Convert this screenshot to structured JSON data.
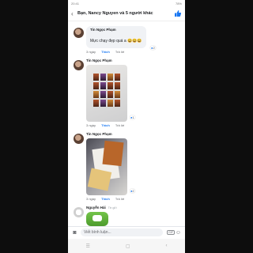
{
  "status_bar": {
    "time": "20:41",
    "battery": "78%"
  },
  "header": {
    "title": "Bạn, Nancy Nguyen và 5 người khác",
    "back_icon": "arrow-left-icon",
    "like_icon": "thumbs-up-icon"
  },
  "comments": [
    {
      "author": "Tin Ngọc Phạm",
      "text": "Mực chạy đẹp quá a 😆😆😆",
      "reaction_count": "2",
      "time": "3 ngày",
      "like": "Thích",
      "reply": "Trả lời"
    },
    {
      "author": "Tin Ngọc Phạm",
      "reaction_count": "1",
      "time": "3 ngày",
      "like": "Thích",
      "reply": "Trả lời"
    },
    {
      "author": "Tin Ngọc Phạm",
      "reaction_count": "2",
      "time": "3 ngày",
      "like": "Thích",
      "reply": "Trả lời"
    },
    {
      "author": "Nguyễn Hải",
      "status": "Tin gửi"
    }
  ],
  "input": {
    "placeholder": "Viết bình luận...",
    "gif_label": "GIF"
  },
  "colors": {
    "accent": "#1877f2",
    "bubble": "#f0f2f5"
  }
}
